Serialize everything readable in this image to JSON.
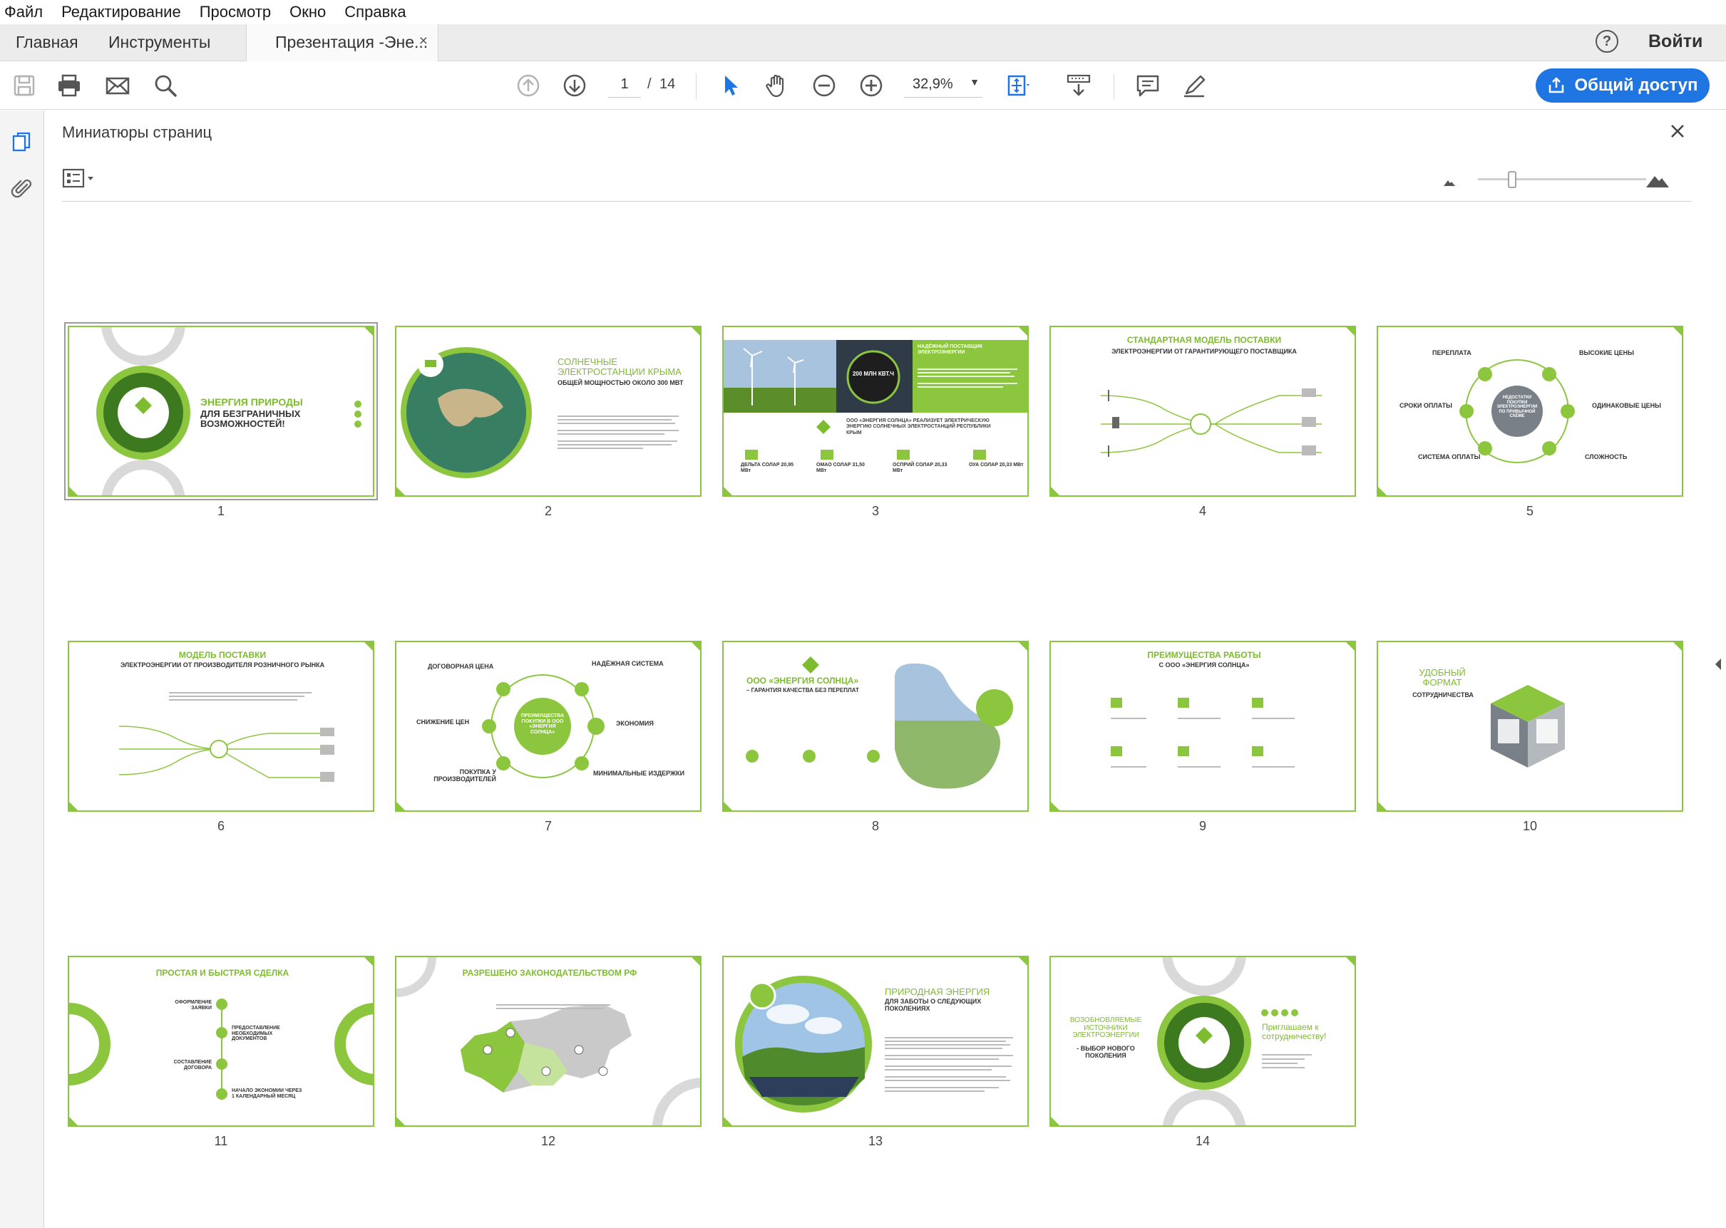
{
  "menu": [
    "Файл",
    "Редактирование",
    "Просмотр",
    "Окно",
    "Справка"
  ],
  "tabs": {
    "home": "Главная",
    "tools": "Инструменты",
    "document": "Презентация -Эне...",
    "close": "×"
  },
  "header": {
    "help": "?",
    "signin": "Войти"
  },
  "toolbar": {
    "page_current": "1",
    "page_separator": "/",
    "page_total": "14",
    "zoom": "32,9%",
    "share": "Общий доступ"
  },
  "panel": {
    "title": "Миниатюры страниц"
  },
  "accent_color": "#8cc63f",
  "share_color": "#1f76e3",
  "thumbnails": [
    {
      "number": "1",
      "selected": true,
      "title": "ЭНЕРГИЯ ПРИРОДЫ",
      "subtitle": "ДЛЯ БЕЗГРАНИЧНЫХ ВОЗМОЖНОСТЕЙ!"
    },
    {
      "number": "2",
      "title": "СОЛНЕЧНЫЕ ЭЛЕКТРОСТАНЦИИ КРЫМА",
      "subtitle": "ОБЩЕЙ МОЩНОСТЬЮ ОКОЛО 300 МВТ"
    },
    {
      "number": "3",
      "title": "НАДЁЖНЫЙ ПОСТАВЩИК ЭЛЕКТРОЭНЕРГИИ",
      "subtitle": "ООО «ЭНЕРГИЯ СОЛНЦА» РЕАЛИЗУЕТ ЭЛЕКТРИЧЕСКУЮ ЭНЕРГИЮ СОЛНЕЧНЫХ ЭЛЕКТРОСТАНЦИЙ РЕСПУБЛИКИ КРЫМ",
      "badge": "200 МЛН КВТ.Ч",
      "stations": [
        "ДЕЛЬТА СОЛАР 20,95 МВт",
        "ОМАО СОЛАР 31,50 МВт",
        "ОСПРИЙ СОЛАР 20,33 МВт",
        "ОУА СОЛАР 20,33 МВт"
      ]
    },
    {
      "number": "4",
      "title": "СТАНДАРТНАЯ МОДЕЛЬ ПОСТАВКИ",
      "subtitle": "ЭЛЕКТРОЭНЕРГИИ ОТ ГАРАНТИРУЮЩЕГО ПОСТАВЩИКА"
    },
    {
      "number": "5",
      "center": "НЕДОСТАТКИ ПОКУПКИ ЭЛЕКТРОЭНЕРГИИ ПО ПРИВЫЧНОЙ СХЕМЕ",
      "labels": [
        "ПЕРЕПЛАТА",
        "ВЫСОКИЕ ЦЕНЫ",
        "СРОКИ ОПЛАТЫ",
        "ОДИНАКОВЫЕ ЦЕНЫ",
        "СИСТЕМА ОПЛАТЫ",
        "СЛОЖНОСТЬ"
      ]
    },
    {
      "number": "6",
      "title": "МОДЕЛЬ ПОСТАВКИ",
      "subtitle": "ЭЛЕКТРОЭНЕРГИИ ОТ ПРОИЗВОДИТЕЛЯ РОЗНИЧНОГО РЫНКА"
    },
    {
      "number": "7",
      "center": "ПРЕИМУЩЕСТВА ПОКУПКИ В ООО «ЭНЕРГИЯ СОЛНЦА»",
      "labels": [
        "ДОГОВОРНАЯ ЦЕНА",
        "НАДЁЖНАЯ СИСТЕМА",
        "СНИЖЕНИЕ ЦЕН",
        "ЭКОНОМИЯ",
        "ПОКУПКА У ПРОИЗВОДИТЕЛЕЙ",
        "МИНИМАЛЬНЫЕ ИЗДЕРЖКИ"
      ]
    },
    {
      "number": "8",
      "title": "ООО «ЭНЕРГИЯ СОЛНЦА»",
      "subtitle": "– ГАРАНТИЯ КАЧЕСТВА БЕЗ ПЕРЕПЛАТ"
    },
    {
      "number": "9",
      "title": "ПРЕИМУЩЕСТВА РАБОТЫ",
      "subtitle": "С ООО «ЭНЕРГИЯ СОЛНЦА»"
    },
    {
      "number": "10",
      "title": "УДОБНЫЙ ФОРМАТ",
      "subtitle": "СОТРУДНИЧЕСТВА"
    },
    {
      "number": "11",
      "title": "ПРОСТАЯ И БЫСТРАЯ СДЕЛКА",
      "labels": [
        "ОФОРМЛЕНИЕ ЗАЯВКИ",
        "ПРЕДОСТАВЛЕНИЕ НЕОБХОДИМЫХ ДОКУМЕНТОВ",
        "СОСТАВЛЕНИЕ ДОГОВОРА",
        "НАЧАЛО ЭКОНОМИИ ЧЕРЕЗ 1 КАЛЕНДАРНЫЙ МЕСЯЦ"
      ]
    },
    {
      "number": "12",
      "title": "РАЗРЕШЕНО ЗАКОНОДАТЕЛЬСТВОМ РФ"
    },
    {
      "number": "13",
      "title": "ПРИРОДНАЯ ЭНЕРГИЯ",
      "subtitle": "ДЛЯ ЗАБОТЫ О СЛЕДУЮЩИХ ПОКОЛЕНИЯХ"
    },
    {
      "number": "14",
      "title": "ВОЗОБНОВЛЯЕМЫЕ ИСТОЧНИКИ ЭЛЕКТРОЭНЕРГИИ",
      "subtitle": "- ВЫБОР НОВОГО ПОКОЛЕНИЯ",
      "invite": "Приглашаем к сотрудничеству!"
    }
  ]
}
